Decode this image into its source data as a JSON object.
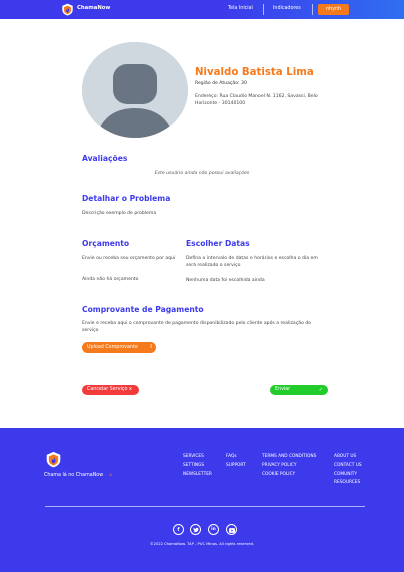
{
  "header": {
    "brand": "ChamaNow",
    "nav": {
      "inicio": "Tela Inicial",
      "indicadores": "Indicadores",
      "user": "nhynh"
    }
  },
  "profile": {
    "name": "Nivaldo Batista Lima",
    "region": "Região de Atuação: 30",
    "address": "Endereço: Rua Claudio Manoel N. 1162, Savassi, Belo Horizonte - 30140100"
  },
  "reviews": {
    "title": "Avaliações",
    "empty": "Este usuário ainda não possui avaliações"
  },
  "problem": {
    "title": "Detalhar o Problema",
    "description": "Descrição exemplo de problema"
  },
  "budget": {
    "title": "Orçamento",
    "text": "Envie ou receba seu orçamento por aqui",
    "empty": "Ainda não há orçamento"
  },
  "dates": {
    "title": "Escolher Datas",
    "text": "Defina o intervalo de datas e horários e escolha o dia em será realizado o serviço",
    "empty": "Nenhuma data foi escolhida ainda"
  },
  "payment": {
    "title": "Comprovante de Pagamento",
    "text": "Envie e receba aqui o comprovante de pagamento disponibilizado pelo cliente após a realização do serviço",
    "upload_label": "Upload Comprovante"
  },
  "actions": {
    "cancel": "Cancelar Serviço",
    "cancel_symbol": "x",
    "send": "Enviar"
  },
  "footer": {
    "slogan": "Chama lá no ChamaNow",
    "links_col1": [
      "SERVICES",
      "SETTINGS",
      "NEWSLETTER"
    ],
    "links_col2": [
      "FAQs",
      "SUPPORT"
    ],
    "links_col3": [
      "TERMS AND CONDITIONS",
      "PRIVACY POLICY",
      "COOKIE POLICY"
    ],
    "links_col4": [
      "ABOUT US",
      "CONTACT US",
      "COMUNITY",
      "RESOURCES"
    ],
    "social": [
      "f",
      "t",
      "in",
      "yt"
    ],
    "copyright": "©2022 ChamaNow. TAP - PUC Minas. All rights reserved."
  },
  "colors": {
    "primary": "#3d3aec",
    "accent": "#f57a1c",
    "danger": "#f23c3c",
    "success": "#22cc2a"
  }
}
